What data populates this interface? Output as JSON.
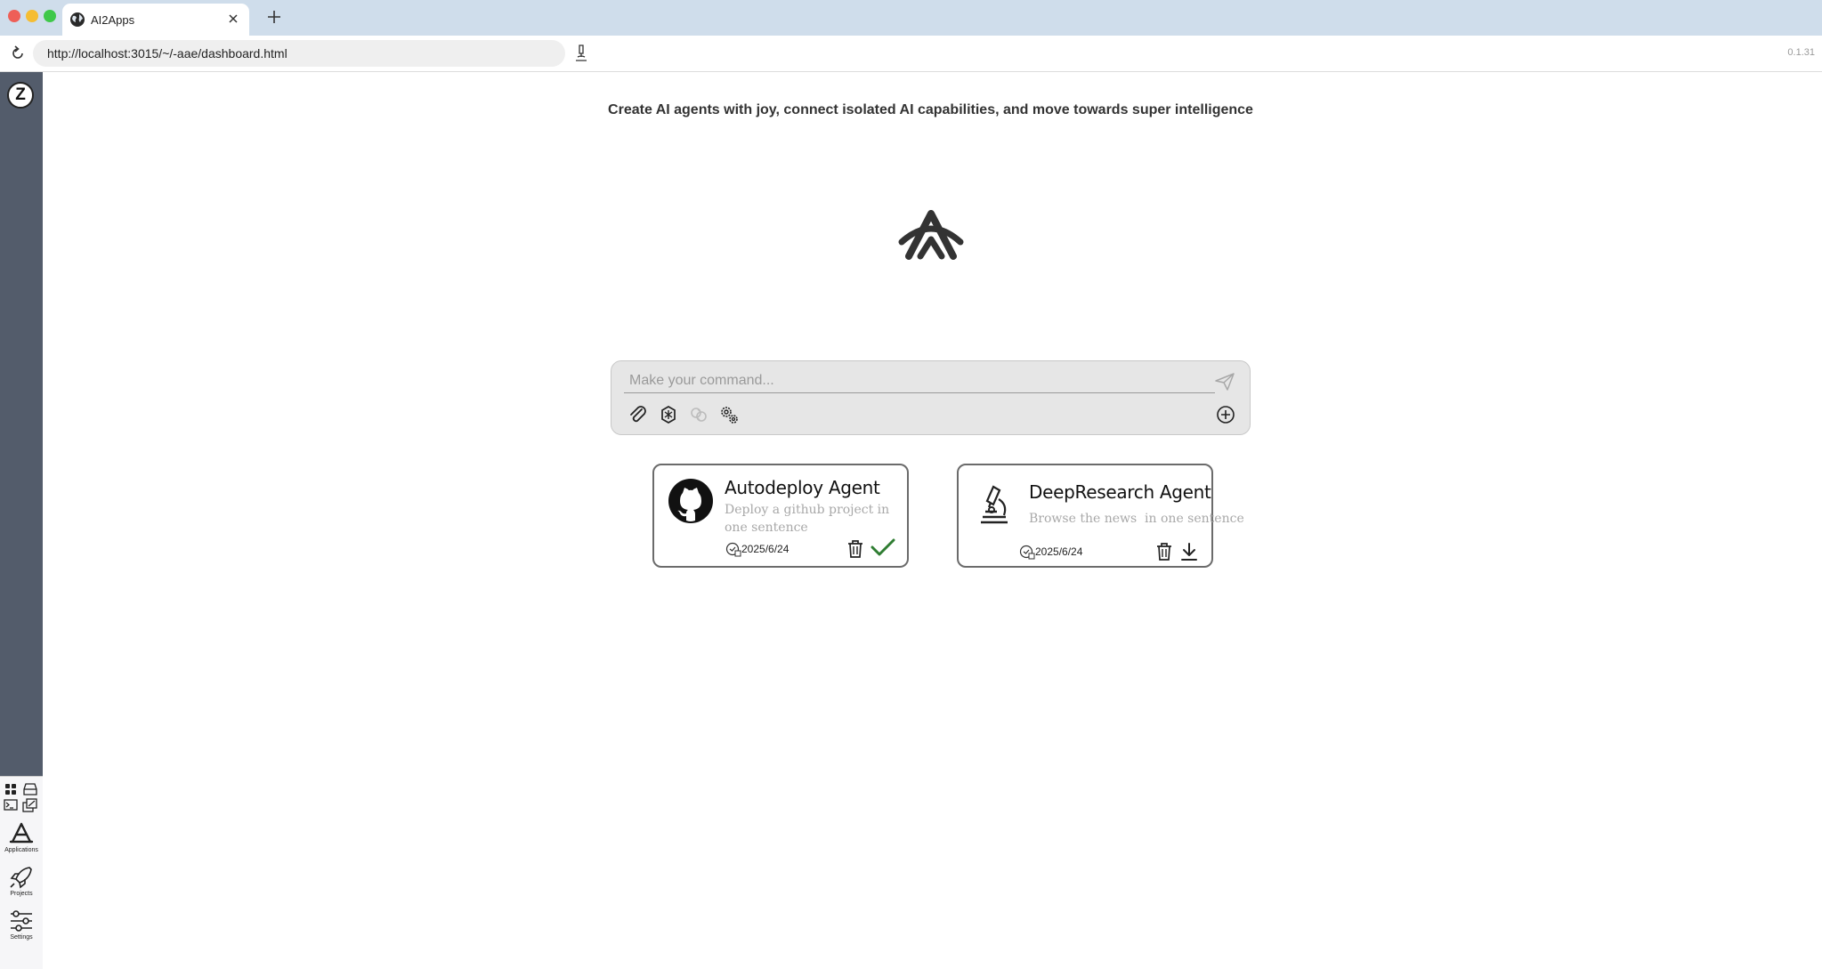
{
  "browser": {
    "tab_title": "AI2Apps",
    "url": "http://localhost:3015/~/-aae/dashboard.html",
    "version": "0.1.31"
  },
  "sidebar": {
    "logo_letter": "Z",
    "nav": [
      {
        "label": "Applications",
        "icon": "app-store-icon"
      },
      {
        "label": "Projects",
        "icon": "rocket-icon"
      },
      {
        "label": "Settings",
        "icon": "sliders-icon"
      }
    ]
  },
  "main": {
    "tagline": "Create AI agents with joy, connect isolated AI capabilities, and move towards super intelligence",
    "command": {
      "placeholder": "Make your command...",
      "value": ""
    },
    "agents": [
      {
        "title": "Autodeploy Agent",
        "description": "Deploy a github project in one sentence",
        "date": "2025/6/24",
        "icon": "github-icon",
        "status": "installed"
      },
      {
        "title": "DeepResearch Agent",
        "description": "Browse the news  in one sentence",
        "date": "2025/6/24",
        "icon": "microscope-icon",
        "status": "downloadable"
      }
    ]
  },
  "colors": {
    "sidebar_bg": "#535c6b",
    "tabstrip_bg": "#cfddeb",
    "check_green": "#2f7d32"
  }
}
